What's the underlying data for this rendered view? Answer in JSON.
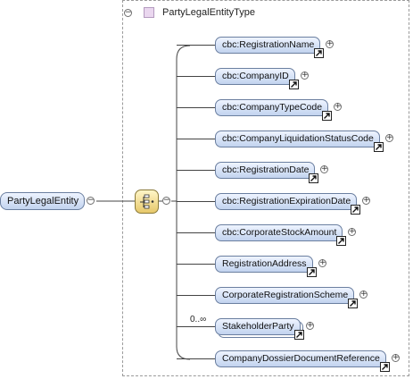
{
  "root": {
    "label": "PartyLegalEntity"
  },
  "type": {
    "label": "PartyLegalEntityType"
  },
  "elements": [
    {
      "label": "cbc:RegistrationName"
    },
    {
      "label": "cbc:CompanyID"
    },
    {
      "label": "cbc:CompanyTypeCode"
    },
    {
      "label": "cbc:CompanyLiquidationStatusCode"
    },
    {
      "label": "cbc:RegistrationDate"
    },
    {
      "label": "cbc:RegistrationExpirationDate"
    },
    {
      "label": "cbc:CorporateStockAmount"
    },
    {
      "label": "RegistrationAddress"
    },
    {
      "label": "CorporateRegistrationScheme"
    },
    {
      "label": "StakeholderParty",
      "cardinality": "0..∞"
    },
    {
      "label": "CompanyDossierDocumentReference"
    }
  ],
  "symbols": {
    "collapse": "−",
    "expand": "+"
  }
}
